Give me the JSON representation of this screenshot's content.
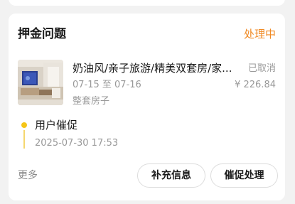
{
  "card": {
    "title": "押金问题",
    "status": "处理中"
  },
  "order": {
    "name": "奶油风/亲子旅游/精美双套房/家...",
    "status": "已取消",
    "dates": "07-15 至 07-16",
    "price": "¥ 226.84",
    "room_type": "整套房子",
    "thumbnail_icon": "room-photo"
  },
  "timeline": {
    "title": "用户催促",
    "time": "2025-07-30 17:53",
    "dot_color": "#f5c518"
  },
  "footer": {
    "more_label": "更多",
    "supplement_label": "补充信息",
    "urge_label": "催促处理"
  },
  "colors": {
    "accent": "#f08a24",
    "background": "#f2f2f2"
  }
}
